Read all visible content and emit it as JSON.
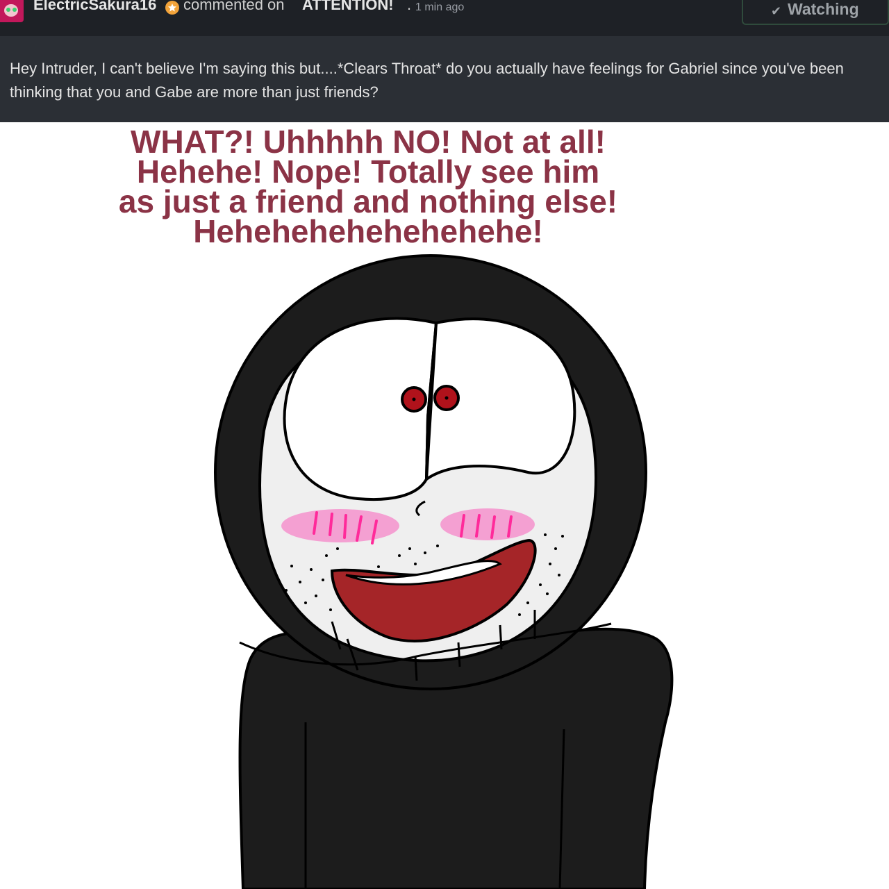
{
  "comment": {
    "username": "ElectricSakura16",
    "action": "commented on",
    "deviation_title": "ATTENTION!",
    "separator": ".",
    "time_ago": "1 min ago",
    "watch_button": {
      "icon": "checkmark-icon",
      "label": "Watching"
    },
    "body": "Hey Intruder, I can't believe I'm saying this but....*Clears Throat* do you actually have feelings for Gabriel since you've been thinking that you and Gabe are more than just friends?"
  },
  "artwork": {
    "speech_lines": [
      "WHAT?! Uhhhhh NO! Not at all!",
      "Hehehe! Nope! Totally see him",
      "as just a friend and nothing else!",
      "Hehehehehehehehehe!"
    ],
    "colors": {
      "speech_text": "#8b3346",
      "hood": "#1c1c1c",
      "face": "#efefef",
      "eyes": "#b0121b",
      "blush": "#f4a0d2",
      "mouth": "#a52528",
      "header_bg": "#1e2126",
      "comment_bg": "#2b2f35"
    }
  }
}
